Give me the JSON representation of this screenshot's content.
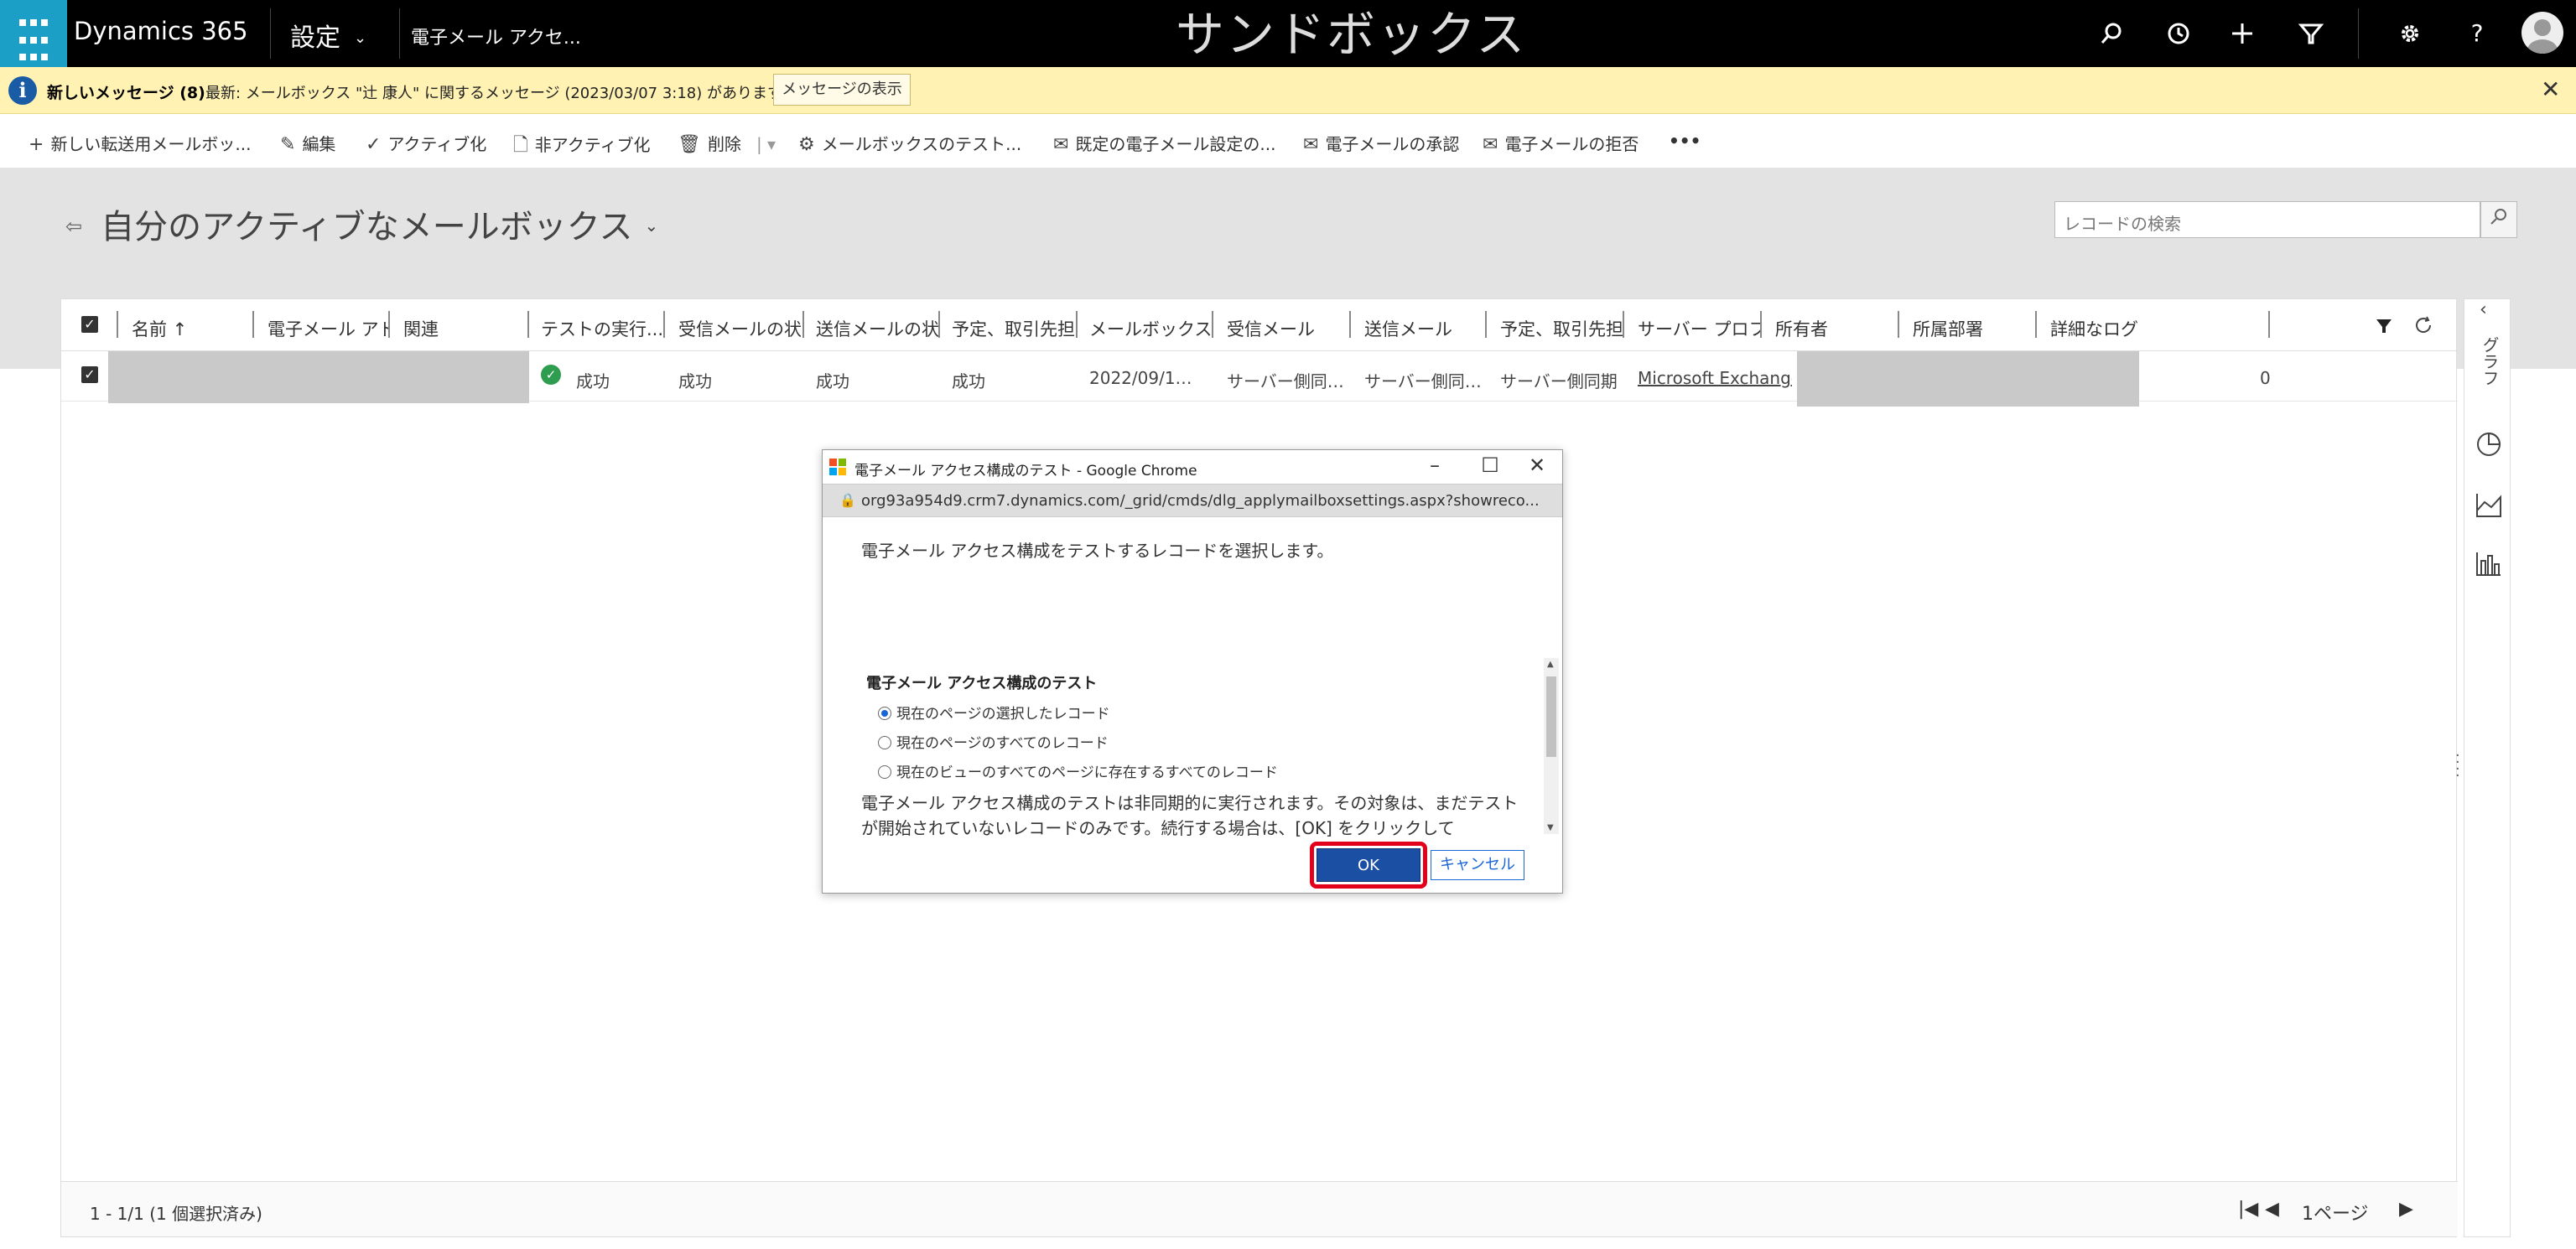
{
  "topbar": {
    "brand": "Dynamics 365",
    "area": "設定",
    "breadcrumb": "電子メール アクセ...",
    "environment": "サンドボックス",
    "icons": [
      "search-icon",
      "history-icon",
      "plus-icon",
      "filter-icon",
      "gear-icon",
      "help-icon",
      "avatar"
    ]
  },
  "message_bar": {
    "title": "新しいメッセージ (8)",
    "text": "最新: メールボックス \"辻 康人\" に関するメッセージ (2023/03/07 3:18) があります。",
    "button": "メッセージの表示",
    "close": "✕"
  },
  "command_bar": {
    "items": [
      {
        "icon": "plus-icon",
        "glyph": "+",
        "label": "新しい転送用メールボッ..."
      },
      {
        "icon": "edit-icon",
        "glyph": "✎",
        "label": "編集"
      },
      {
        "icon": "check-icon",
        "glyph": "✓",
        "label": "アクティブ化"
      },
      {
        "icon": "deactivate-icon",
        "glyph": "🗋",
        "label": "非アクティブ化"
      },
      {
        "icon": "delete-icon",
        "glyph": "🗑",
        "label": "削除"
      },
      {
        "icon": "test-mailbox-icon",
        "glyph": "⚙",
        "label": "メールボックスのテスト..."
      },
      {
        "icon": "default-settings-icon",
        "glyph": "✉",
        "label": "既定の電子メール設定の..."
      },
      {
        "icon": "approve-email-icon",
        "glyph": "✉",
        "label": "電子メールの承認"
      },
      {
        "icon": "reject-email-icon",
        "glyph": "✉",
        "label": "電子メールの拒否"
      }
    ],
    "more": "•••"
  },
  "view": {
    "title": "自分のアクティブなメールボックス",
    "search_placeholder": "レコードの検索"
  },
  "grid": {
    "columns": [
      "名前 ↑",
      "電子メール アドレス",
      "関連",
      "テストの実行...",
      "受信メールの状態",
      "送信メールの状態",
      "予定、取引先担当者",
      "メールボックス",
      "受信メール",
      "送信メール",
      "予定、取引先担",
      "サーバー プロファイル",
      "所有者",
      "所属部署",
      "詳細なログ"
    ],
    "rows": [
      {
        "test_status": "成功",
        "incoming": "成功",
        "outgoing": "成功",
        "appointments": "成功",
        "mailbox_date": "2022/09/1…",
        "incoming_mail": "サーバー側同…",
        "outgoing_mail": "サーバー側同…",
        "appointments_sync": "サーバー側同期",
        "server_profile": "Microsoft Exchange",
        "detailed_log": "0"
      }
    ],
    "footer_count": "1 - 1/1 (1 個選択済み)",
    "page_label": "1ページ"
  },
  "side_panel": {
    "label": "グラフ"
  },
  "dialog": {
    "window_title": "電子メール アクセス構成のテスト - Google Chrome",
    "url": "org93a954d9.crm7.dynamics.com/_grid/cmds/dlg_applymailboxsettings.aspx?showreco...",
    "intro": "電子メール アクセス構成をテストするレコードを選択します。",
    "section_title": "電子メール アクセス構成のテスト",
    "options": [
      {
        "label": "現在のページの選択したレコード",
        "selected": true
      },
      {
        "label": "現在のページのすべてのレコード",
        "selected": false
      },
      {
        "label": "現在のビューのすべてのページに存在するすべてのレコード",
        "selected": false
      }
    ],
    "description": "電子メール アクセス構成のテストは非同期的に実行されます。その対象は、まだテストが開始されていないレコードのみです。続行する場合は、[OK] をクリックして",
    "ok": "OK",
    "cancel": "キャンセル"
  }
}
